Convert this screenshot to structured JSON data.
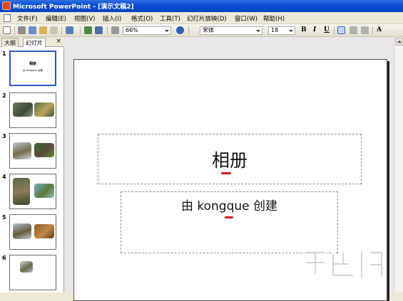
{
  "window": {
    "title": "Microsoft PowerPoint - [演示文稿2]"
  },
  "menu": [
    {
      "label": "文件(F)"
    },
    {
      "label": "编辑(E)"
    },
    {
      "label": "视图(V)"
    },
    {
      "label": "插入(I)"
    },
    {
      "label": "格式(O)"
    },
    {
      "label": "工具(T)"
    },
    {
      "label": "幻灯片放映(D)"
    },
    {
      "label": "窗口(W)"
    },
    {
      "label": "帮助(H)"
    }
  ],
  "toolbar": {
    "zoom": "66%",
    "font": "宋体",
    "font_size": "18",
    "bold": "B",
    "italic": "I",
    "underline": "U"
  },
  "left_pane": {
    "tabs": [
      "大纲",
      "幻灯片"
    ],
    "close": "×",
    "slides": [
      {
        "number": "1",
        "title": "相册",
        "subtitle": "由 kongque 创建"
      },
      {
        "number": "2"
      },
      {
        "number": "3"
      },
      {
        "number": "4"
      },
      {
        "number": "5"
      },
      {
        "number": "6"
      }
    ]
  },
  "slide": {
    "title": "相册",
    "subtitle": "由 kongque 创建"
  },
  "colors": {
    "titlebar": "#0a4fd4",
    "accent_red": "#d01818",
    "selection": "#2d58b7"
  }
}
